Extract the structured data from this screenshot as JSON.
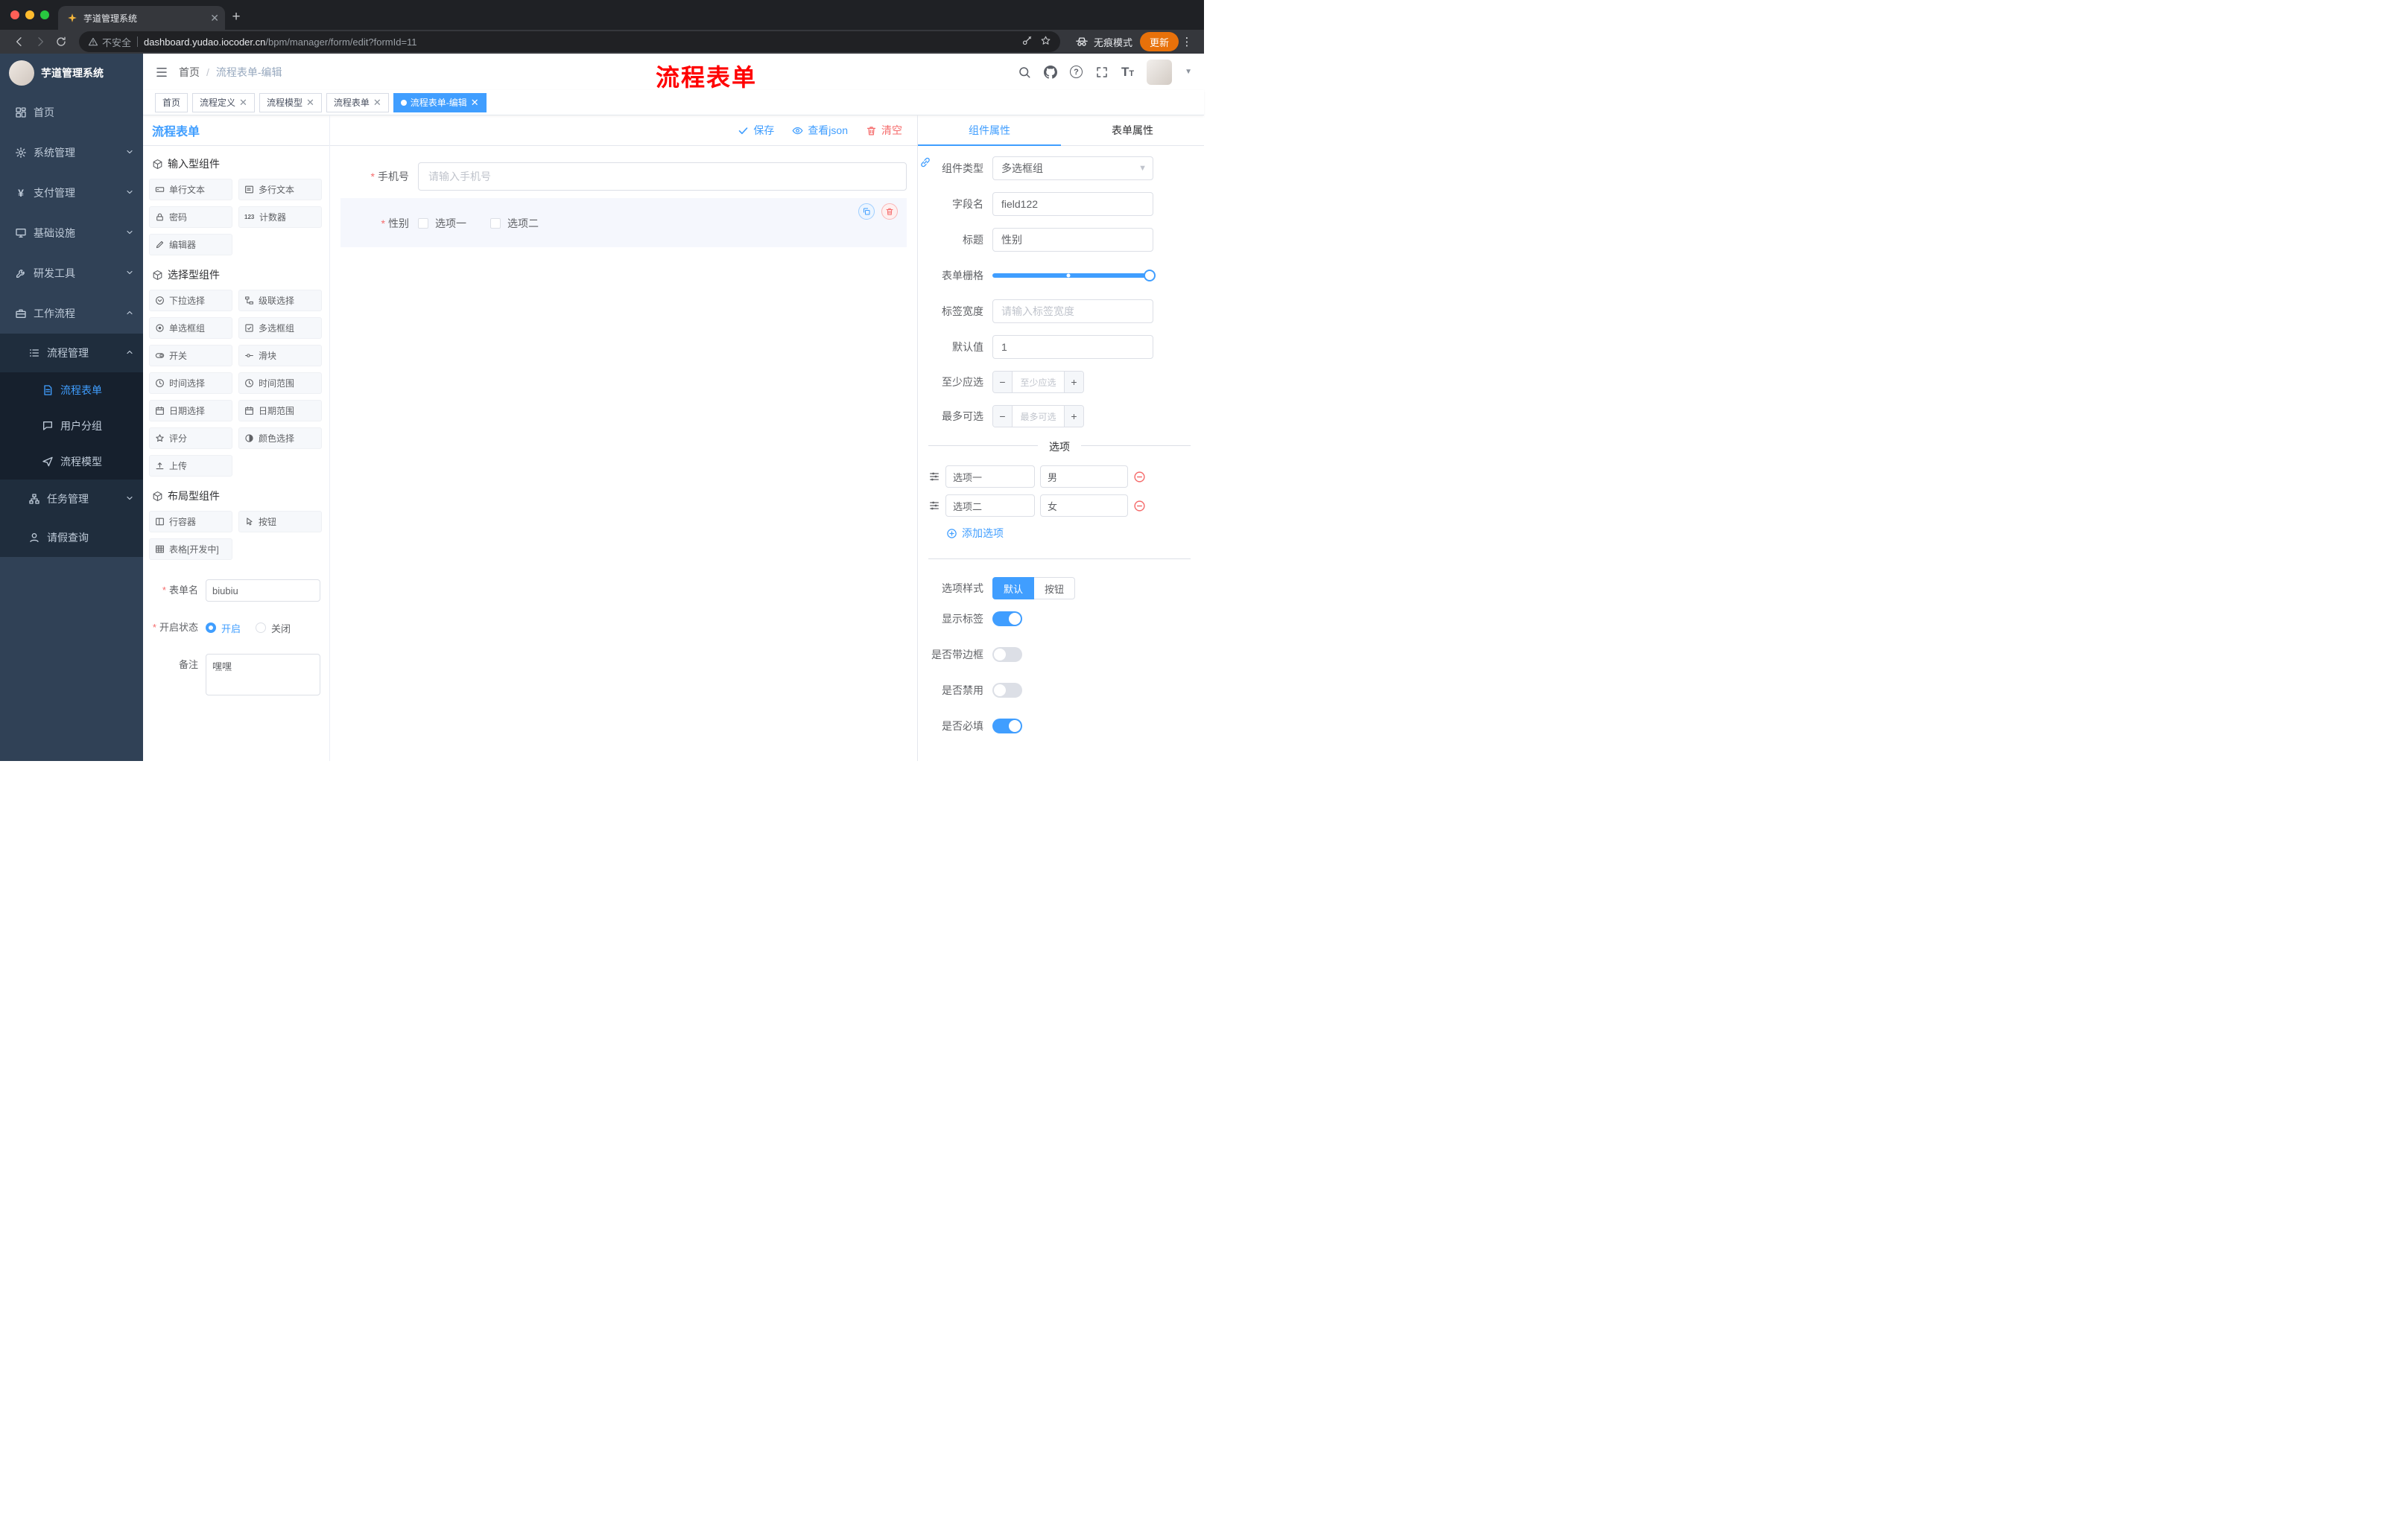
{
  "colors": {
    "accent": "#409eff",
    "danger": "#f56c6c",
    "sidebar_bg": "#304156",
    "sidebar_sub_bg": "#1f2d3d",
    "update_button": "#e8710a",
    "annotation_red": "#ff0000",
    "active_tag_bg": "#409eff"
  },
  "browser": {
    "tab_title": "芋道管理系统",
    "security_label": "不安全",
    "url_host": "dashboard.yudao.iocoder.cn",
    "url_path": "/bpm/manager/form/edit?formId=11",
    "incognito_label": "无痕模式",
    "update_label": "更新"
  },
  "sidebar": {
    "logo_title": "芋道管理系统",
    "items": [
      {
        "label": "首页"
      },
      {
        "label": "系统管理"
      },
      {
        "label": "支付管理"
      },
      {
        "label": "基础设施"
      },
      {
        "label": "研发工具"
      },
      {
        "label": "工作流程"
      },
      {
        "label": "流程管理"
      },
      {
        "label": "流程表单"
      },
      {
        "label": "用户分组"
      },
      {
        "label": "流程模型"
      },
      {
        "label": "任务管理"
      },
      {
        "label": "请假查询"
      }
    ]
  },
  "header": {
    "breadcrumb_home": "首页",
    "breadcrumb_current": "流程表单-编辑",
    "annotation": "流程表单"
  },
  "tags": [
    {
      "label": "首页"
    },
    {
      "label": "流程定义"
    },
    {
      "label": "流程模型"
    },
    {
      "label": "流程表单"
    },
    {
      "label": "流程表单-编辑"
    }
  ],
  "palette": {
    "title": "流程表单",
    "groups": [
      {
        "title": "输入型组件",
        "items": [
          "单行文本",
          "多行文本",
          "密码",
          "计数器",
          "编辑器"
        ]
      },
      {
        "title": "选择型组件",
        "items": [
          "下拉选择",
          "级联选择",
          "单选框组",
          "多选框组",
          "开关",
          "滑块",
          "时间选择",
          "时间范围",
          "日期选择",
          "日期范围",
          "评分",
          "颜色选择",
          "上传"
        ]
      },
      {
        "title": "布局型组件",
        "items": [
          "行容器",
          "按钮",
          "表格[开发中]"
        ]
      }
    ],
    "form": {
      "name_label": "表单名",
      "name_value": "biubiu",
      "status_label": "开启状态",
      "status_on": "开启",
      "status_off": "关闭",
      "remark_label": "备注",
      "remark_value": "嘿嘿"
    }
  },
  "canvas": {
    "toolbar": {
      "save": "保存",
      "view_json": "查看json",
      "clear": "清空"
    },
    "phone": {
      "label": "手机号",
      "placeholder": "请输入手机号"
    },
    "gender": {
      "label": "性别",
      "options": [
        "选项一",
        "选项二"
      ]
    }
  },
  "inspector": {
    "tab_component": "组件属性",
    "tab_form": "表单属性",
    "component_type_label": "组件类型",
    "component_type_value": "多选框组",
    "field_name_label": "字段名",
    "field_name_value": "field122",
    "title_label": "标题",
    "title_value": "性别",
    "grid_label": "表单栅格",
    "label_width_label": "标签宽度",
    "label_width_placeholder": "请输入标签宽度",
    "default_label": "默认值",
    "default_value": "1",
    "min_label": "至少应选",
    "min_placeholder": "至少应选",
    "max_label": "最多可选",
    "max_placeholder": "最多可选",
    "options_title": "选项",
    "options": [
      {
        "label": "选项一",
        "value": "男"
      },
      {
        "label": "选项二",
        "value": "女"
      }
    ],
    "add_option": "添加选项",
    "style_label": "选项样式",
    "style_default": "默认",
    "style_button": "按钮",
    "show_label": "显示标签",
    "border_label": "是否带边框",
    "disabled_label": "是否禁用",
    "required_label": "是否必填"
  }
}
